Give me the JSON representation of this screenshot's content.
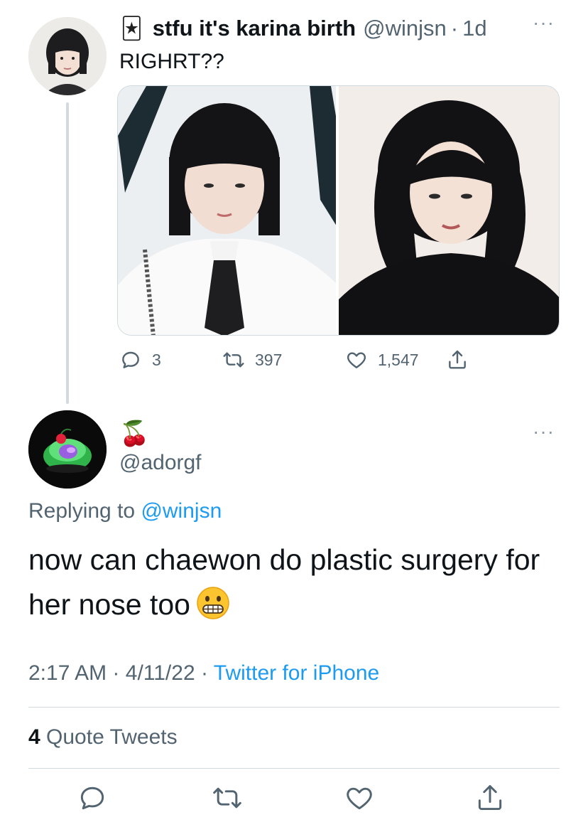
{
  "parent_tweet": {
    "author_emoji": "🃏",
    "author_name": "stfu it's karina birth",
    "handle": "@winjsn",
    "separator": "·",
    "age": "1d",
    "text": "RIGHRT??",
    "more_label": "···",
    "actions": {
      "replies": "3",
      "retweets": "397",
      "likes": "1,547"
    },
    "icons": [
      "reply-icon",
      "retweet-icon",
      "like-icon",
      "share-icon"
    ]
  },
  "reply_tweet": {
    "author_emoji": "🍒",
    "handle": "@adorgf",
    "more_label": "···",
    "replying_prefix": "Replying to",
    "replying_handle": "@winjsn",
    "text": "now can chaewon do plastic surgery for her nose too",
    "trailing_emoji": "grimacing-face",
    "time": "2:17 AM",
    "date": "4/11/22",
    "meta_separator": "·",
    "source": "Twitter for iPhone",
    "quote_count": "4",
    "quote_label": "Quote Tweets"
  },
  "colors": {
    "text": "#0f1419",
    "secondary": "#536471",
    "link": "#1d9bf0",
    "border": "#cfd9de",
    "thread_line": "#d4d9dd"
  }
}
